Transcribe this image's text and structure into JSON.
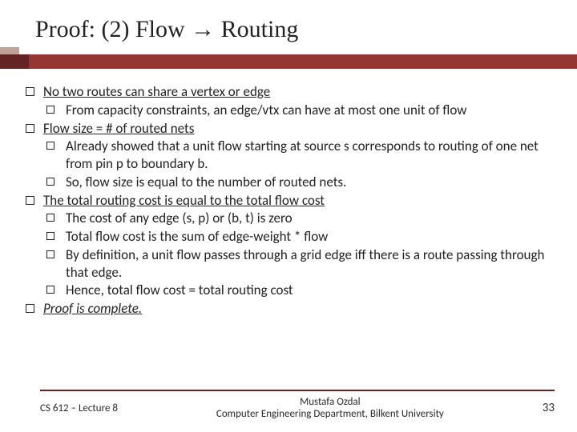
{
  "title": "Proof: (2) Flow → Routing",
  "bullets": {
    "b1": {
      "text": "No two routes can share a vertex or edge",
      "sub": {
        "s1": "From capacity constraints, an edge/vtx can have at most one unit of flow"
      }
    },
    "b2": {
      "text": "Flow size = # of routed nets",
      "sub": {
        "s1": "Already showed that a unit flow starting at source s corresponds to routing of one net from pin p to boundary b.",
        "s2": "So, flow size is equal to the number of routed nets."
      }
    },
    "b3": {
      "text": "The total routing cost is equal to the total flow cost",
      "sub": {
        "s1": "The cost of any edge (s, p) or (b, t) is zero",
        "s2": "Total flow cost is the sum of edge-weight * flow",
        "s3": "By definition, a unit flow passes through a grid edge iff there is a route passing through that edge.",
        "s4": "Hence, total flow cost = total routing cost"
      }
    },
    "b4": {
      "text": "Proof is complete."
    }
  },
  "footer": {
    "left": "CS 612 – Lecture 8",
    "center_l1": "Mustafa Ozdal",
    "center_l2": "Computer Engineering Department, Bilkent University",
    "page": "33"
  }
}
